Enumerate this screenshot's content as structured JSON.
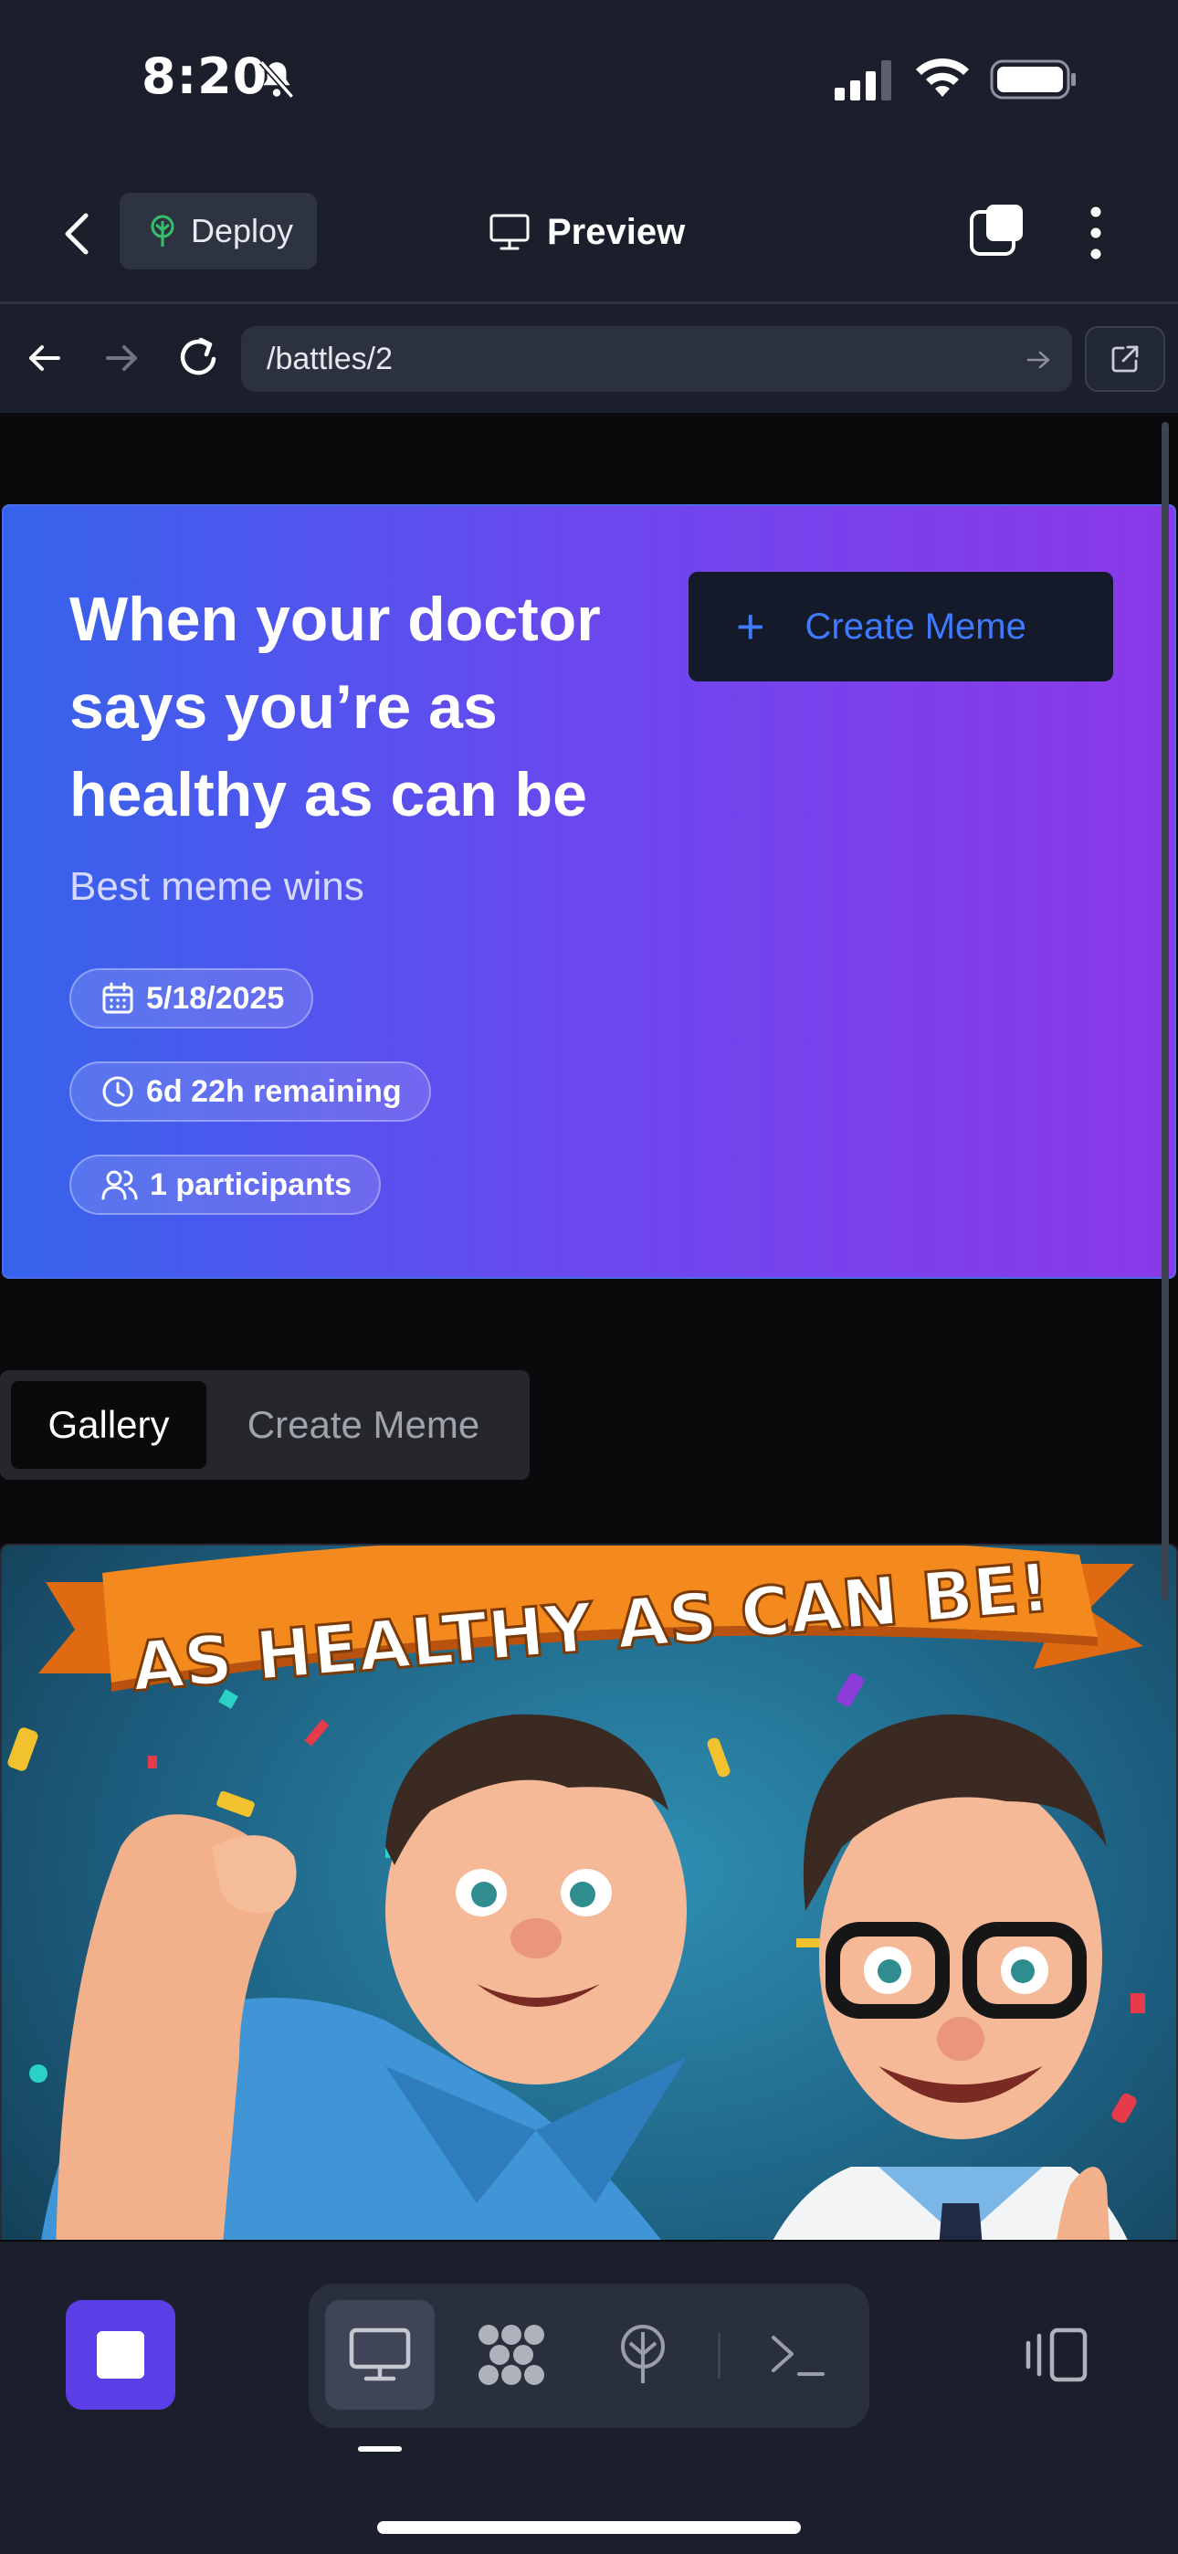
{
  "status_bar": {
    "time": "8:20"
  },
  "top_bar": {
    "deploy_label": "Deploy",
    "preview_label": "Preview"
  },
  "url_bar": {
    "url": "/battles/2"
  },
  "hero": {
    "title": "When your doctor says you’re as healthy as can be",
    "subtitle": "Best meme wins",
    "create_button_label": "Create Meme",
    "date": "5/18/2025",
    "remaining": "6d 22h remaining",
    "participants": "1 participants"
  },
  "tabs": [
    {
      "label": "Gallery",
      "active": true
    },
    {
      "label": "Create Meme",
      "active": false
    }
  ],
  "meme": {
    "banner_text": "AS HEALTHY AS CAN BE!"
  },
  "colors": {
    "accent": "#5b3ee6",
    "hero_gradient_start": "#3563ec",
    "hero_gradient_end": "#8a38e8",
    "link_blue": "#3f7bff",
    "chrome_bg": "#1b1f2c"
  },
  "icons": {
    "back": "chevron-left-icon",
    "deploy": "tree-icon",
    "preview": "monitor-icon",
    "tabs": "tabs-icon",
    "more": "vertical-dots-icon",
    "calendar": "calendar-icon",
    "clock": "clock-icon",
    "users": "users-icon"
  }
}
